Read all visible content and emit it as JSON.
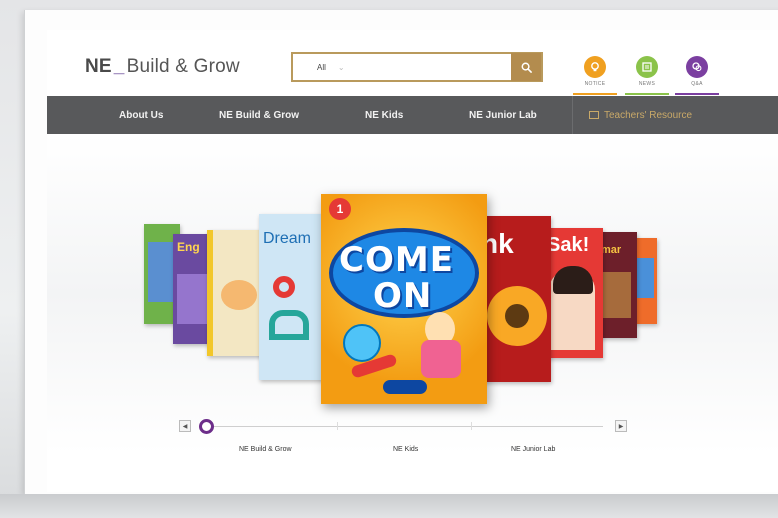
{
  "header": {
    "logo_prefix": "NE",
    "logo_name": "Build & Grow",
    "search": {
      "scope": "All",
      "placeholder": ""
    },
    "quick_links": [
      {
        "label": "NOTICE",
        "icon": "bulb-icon",
        "color": "#f0a020"
      },
      {
        "label": "NEWS",
        "icon": "newspaper-icon",
        "color": "#8bc34a"
      },
      {
        "label": "Q&A",
        "icon": "chat-icon",
        "color": "#7b3fa0"
      }
    ]
  },
  "nav": {
    "items": [
      "About Us",
      "NE Build & Grow",
      "NE Kids",
      "NE Junior Lab"
    ],
    "resource_label": "Teachers' Resource"
  },
  "carousel": {
    "featured": {
      "title_line1": "COME",
      "title_line2": "ON",
      "badge": "1"
    },
    "books_left": [
      {
        "title": "",
        "color": "#6fb24a"
      },
      {
        "title": "",
        "color": "#6a4aa0"
      },
      {
        "title": "",
        "color": "#f3e7c3"
      },
      {
        "title": "Dream",
        "color": "#cfe6f5"
      }
    ],
    "books_right": [
      {
        "title": "nk",
        "color": "#c62828"
      },
      {
        "title": "Sak!",
        "color": "#e53935"
      },
      {
        "title": "mar",
        "color": "#6d1f2a"
      },
      {
        "title": "",
        "color": "#ef6c2a"
      }
    ]
  },
  "slider": {
    "labels": [
      "NE Build & Grow",
      "NE Kids",
      "NE Junior Lab"
    ],
    "position": 0
  },
  "colors": {
    "accent": "#6d2e8a",
    "nav_bg": "#58595b",
    "search_border": "#b99a5c"
  }
}
